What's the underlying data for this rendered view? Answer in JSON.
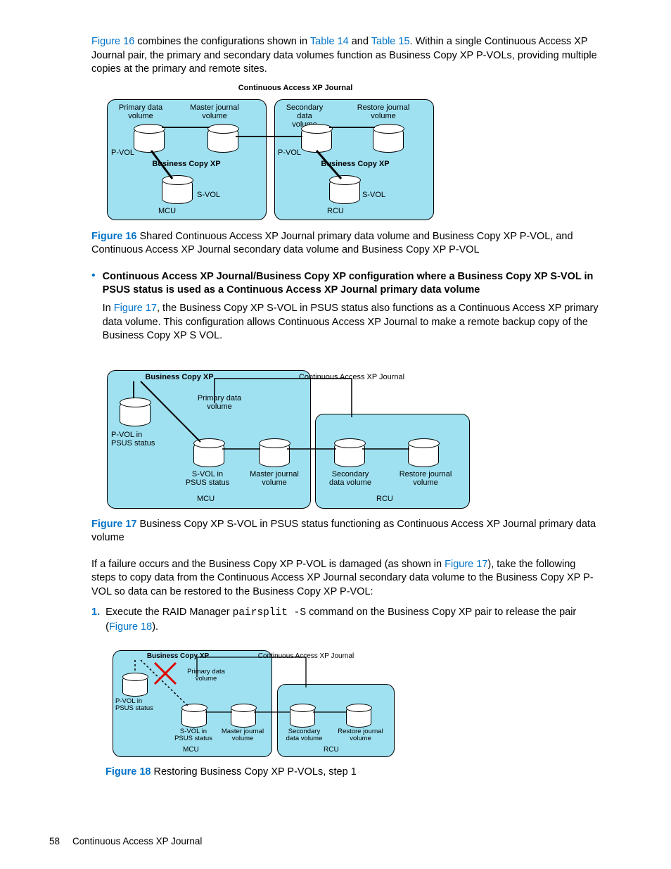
{
  "para1": {
    "fig16": "Figure 16",
    "t1": " combines the configurations shown in ",
    "tab14": "Table 14",
    "t2": " and ",
    "tab15": "Table 15",
    "t3": ". Within a single Continuous Access XP Journal pair, the primary and secondary data volumes function as Business Copy XP P-VOLs, providing multiple copies at the primary and remote sites."
  },
  "diag1": {
    "title": "Continuous Access XP Journal",
    "primary_data": "Primary data\nvolume",
    "master_jnl": "Master journal\nvolume",
    "secondary_data": "Secondary\ndata\nvolume",
    "restore_jnl": "Restore journal\nvolume",
    "pvol": "P-VOL",
    "svol": "S-VOL",
    "bc": "Business Copy XP",
    "mcu": "MCU",
    "rcu": "RCU"
  },
  "cap16": {
    "label": "Figure 16",
    "text": "  Shared Continuous Access XP Journal primary data volume and Business Copy XP P-VOL, and Continuous Access XP Journal secondary data volume and Business Copy XP P-VOL"
  },
  "bullet1": {
    "head": "Continuous Access XP Journal/Business Copy XP configuration where a Business Copy XP S-VOL in PSUS status is used as a Continuous Access XP Journal primary data volume",
    "p_pre": "In ",
    "fig17": "Figure 17",
    "p_post": ", the Business Copy XP S-VOL in PSUS status also functions as a Continuous Access XP primary data volume. This configuration allows Continuous Access XP Journal to make a remote backup copy of the Business Copy XP S VOL."
  },
  "diag2": {
    "bc": "Business Copy XP",
    "caj": "Continuous Access XP Journal",
    "primary_data": "Primary data\nvolume",
    "pvol_psus": "P-VOL in\nPSUS status",
    "svol_psus": "S-VOL in\nPSUS status",
    "master_jnl": "Master journal\nvolume",
    "secondary": "Secondary\ndata volume",
    "restore_jnl": "Restore journal\nvolume",
    "mcu": "MCU",
    "rcu": "RCU"
  },
  "cap17": {
    "label": "Figure 17",
    "text": "  Business Copy XP S-VOL in PSUS status functioning as Continuous Access XP Journal primary data volume"
  },
  "para2": {
    "pre": "If a failure occurs and the Business Copy XP P-VOL is damaged (as shown in ",
    "fig17": "Figure 17",
    "post": "), take the following steps to copy data from the Continuous Access XP Journal secondary data volume to the Business Copy XP P-VOL so data can be restored to the Business Copy XP P-VOL:"
  },
  "step1": {
    "num": "1.",
    "pre": "Execute the RAID Manager ",
    "cmd": "pairsplit -S",
    "mid": " command on the Business Copy XP pair to release the pair (",
    "fig18": "Figure 18",
    "post": ")."
  },
  "cap18": {
    "label": "Figure 18",
    "text": "  Restoring Business Copy XP P-VOLs, step 1"
  },
  "footer": {
    "page": "58",
    "title": "Continuous Access XP Journal"
  }
}
